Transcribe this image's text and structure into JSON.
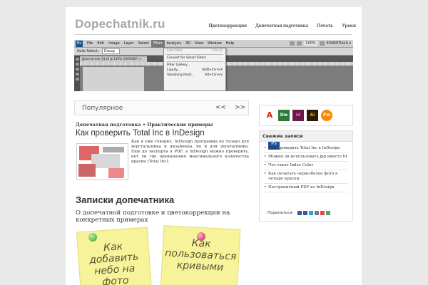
{
  "site": {
    "title": "Dopechatnik.ru"
  },
  "nav": [
    "Цветокоррекция",
    "Допечатная подготовка",
    "Печать",
    "Уроки"
  ],
  "photoshop": {
    "logo": "Ps",
    "menu": [
      "File",
      "Edit",
      "Image",
      "Layer",
      "Select",
      "Filter",
      "Analysis",
      "3D",
      "View",
      "Window",
      "Help"
    ],
    "active_menu": "Filter",
    "zoom": "100%",
    "essentials": "ESSENTIALS ▾",
    "options": {
      "auto_select": "Auto-Select:",
      "group": "Group"
    },
    "doc_tab": "Допечатник_01.tif @ 100% (CMYK/8#) ×",
    "dropdown": [
      {
        "label": "Last Filter",
        "shortcut": "Ctrl+F",
        "dim": true
      },
      {
        "label": "Convert for Smart Filters",
        "shortcut": ""
      },
      {
        "label": "Filter Gallery...",
        "shortcut": ""
      },
      {
        "label": "Liquify...",
        "shortcut": "Shift+Ctrl+X"
      },
      {
        "label": "Vanishing Point...",
        "shortcut": "Alt+Ctrl+V"
      }
    ]
  },
  "popular": {
    "label": "Популярное",
    "prev": "<<",
    "next": ">>"
  },
  "post": {
    "breadcrumbs": "Допечатная подготовка • Практические примеры",
    "title": "Как проверить Total Inc в InDesign",
    "excerpt": "Как я уже говорил, InDesign программа не только для верстальщика и дизайнера, но и для допечатника. Еще до экспорта в PDF, в InDesign можно проверить, нет ли где превышения максимального количества краски (Total Inc)."
  },
  "section": {
    "title": "Записки допечатника",
    "subtitle": "О допечатной подготовке и цветокоррекции на конкретных примерах"
  },
  "notes": [
    {
      "text": "Как добавить небо на фото"
    },
    {
      "text": "Как пользоваться кривыми"
    }
  ],
  "sidebar": {
    "icons": [
      "Ps",
      "A",
      "Dw",
      "Id",
      "Ai",
      "Fw"
    ],
    "fresh_title": "Свежие записи",
    "fresh": [
      "Как проверить Total Inc в InDesign",
      "Можно ли использовать jpg вместо tif",
      "Что такое Index Color",
      "Как печатать черно-белое фото в четыре краски",
      "Постраничный PDF из InDesign"
    ],
    "share_label": "Поделиться:",
    "share_colors": [
      "#2f5fa0",
      "#3b5998",
      "#2aa3e0",
      "#7a7a7a",
      "#e44",
      "#4a7"
    ]
  }
}
